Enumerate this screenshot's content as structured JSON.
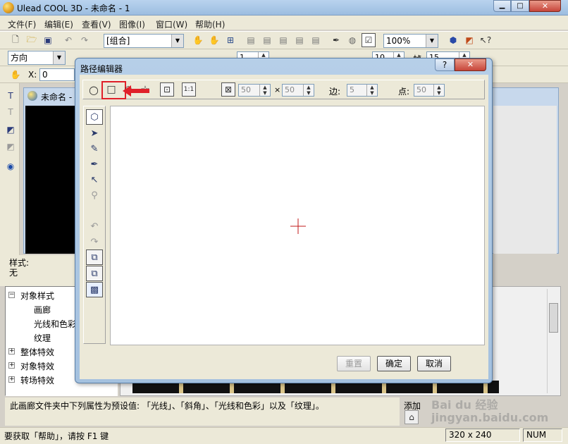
{
  "app": {
    "title": "Ulead COOL 3D - 未命名 - 1",
    "menu": [
      "文件(F)",
      "编辑(E)",
      "查看(V)",
      "图像(I)",
      "窗口(W)",
      "帮助(H)"
    ],
    "toolbar": {
      "object_combo": "[组合]",
      "zoom_combo": "100%"
    },
    "toolbar2": {
      "direction_combo": "方向",
      "spin_a": "1",
      "spin_b": "10",
      "spin_c": "15",
      "spin_c_label": "帧"
    },
    "toolbar3": {
      "x_label": "X:",
      "x_value": "0"
    },
    "doc_tab": "未命名 -",
    "style_label": "样式:",
    "style_value": "无",
    "tree": {
      "root": "对象样式",
      "children": [
        "画廊",
        "光线和色彩",
        "纹理"
      ],
      "others": [
        "整体特效",
        "对象特效",
        "转场特效"
      ]
    },
    "description": "此画廊文件夹中下列属性为预设值: 「光线」、「斜角」、「光线和色彩」以及「纹理」。",
    "add_label": "添加",
    "status": {
      "help": "要获取「帮助」，请按 F1 键",
      "size": "320 x 240",
      "num": "NUM"
    },
    "watermark": "Bai du 经验 jingyan.baidu.com"
  },
  "dialog": {
    "title": "路径编辑器",
    "help_glyph": "?",
    "width": "50",
    "times": "×",
    "height": "50",
    "edges_label": "边:",
    "edges": "5",
    "points_label": "点:",
    "points": "50",
    "buttons": {
      "reset": "重置",
      "ok": "确定",
      "cancel": "取消"
    }
  },
  "colors": {
    "title_glass": "#a9c4e0",
    "highlight": "#e0202a",
    "canvas_bg": "#ffffff",
    "preview_bg": "#000000"
  }
}
